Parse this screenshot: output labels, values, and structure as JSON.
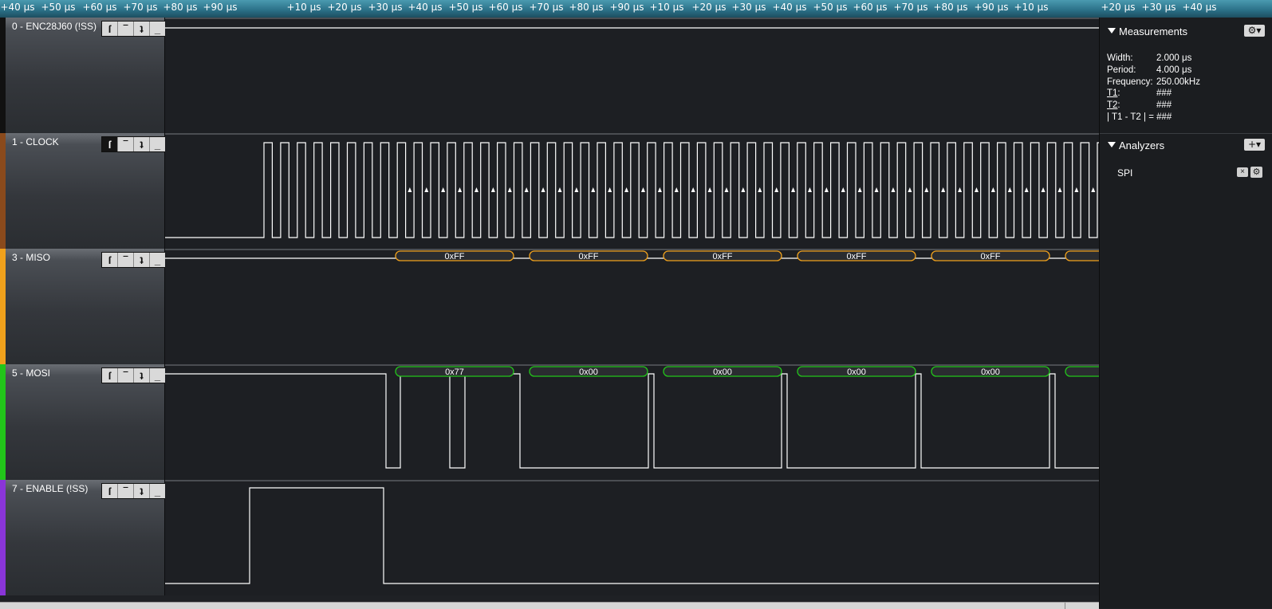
{
  "ruler": {
    "ticks": [
      {
        "label": "+40 μs"
      },
      {
        "label": "+50 μs"
      },
      {
        "label": "+60 μs"
      },
      {
        "label": "+70 μs"
      },
      {
        "label": "+80 μs"
      },
      {
        "label": "+90 μs"
      },
      {
        "label": "+10 μs"
      },
      {
        "label": "+20 μs"
      },
      {
        "label": "+30 μs"
      },
      {
        "label": "+40 μs"
      },
      {
        "label": "+50 μs"
      },
      {
        "label": "+60 μs"
      },
      {
        "label": "+70 μs"
      },
      {
        "label": "+80 μs"
      },
      {
        "label": "+90 μs"
      },
      {
        "label": "+10 μs"
      },
      {
        "label": "+20 μs"
      },
      {
        "label": "+30 μs"
      },
      {
        "label": "+40 μs"
      },
      {
        "label": "+50 μs"
      },
      {
        "label": "+60 μs"
      },
      {
        "label": "+70 μs"
      },
      {
        "label": "+80 μs"
      },
      {
        "label": "+90 μs"
      },
      {
        "label": "+10 μs"
      },
      {
        "label": "+20 μs"
      },
      {
        "label": "+30 μs"
      },
      {
        "label": "+40 μs"
      }
    ]
  },
  "channels": [
    {
      "name": "0 - ENC28J60 (!SS)",
      "color": "#111111"
    },
    {
      "name": "1 - CLOCK",
      "color": "#8a4a1c"
    },
    {
      "name": "3 - MISO",
      "color": "#f0a11c"
    },
    {
      "name": "5 - MOSI",
      "color": "#22c51a"
    },
    {
      "name": "7 - ENABLE (!SS)",
      "color": "#8a35d8"
    }
  ],
  "trigger_buttons": {
    "rising": "ſ",
    "high": "‾",
    "falling": "ʇ",
    "low": "_"
  },
  "decoded": {
    "miso": {
      "color": "#f0a11c",
      "bytes": [
        "0xFF",
        "0xFF",
        "0xFF",
        "0xFF",
        "0xFF",
        ""
      ]
    },
    "mosi": {
      "color": "#22c51a",
      "bytes": [
        "0x77",
        "0x00",
        "0x00",
        "0x00",
        "0x00",
        ""
      ]
    }
  },
  "side": {
    "measurements": {
      "title": "Measurements",
      "gear": "⚙▾",
      "width_label": "Width:",
      "width_value": "2.000 μs",
      "period_label": "Period:",
      "period_value": "4.000 μs",
      "freq_label": "Frequency:",
      "freq_value": "250.00kHz",
      "t1_label": "T1",
      "t1_colon": ":",
      "t1_value": "###",
      "t2_label": "T2",
      "t2_colon": ":",
      "t2_value": "###",
      "diff_label": "| T1 - T2 | =",
      "diff_value": "###"
    },
    "analyzers": {
      "title": "Analyzers",
      "add": "+▾",
      "items": [
        {
          "label": "SPI",
          "remove": "×",
          "settings": "⚙"
        }
      ]
    }
  }
}
